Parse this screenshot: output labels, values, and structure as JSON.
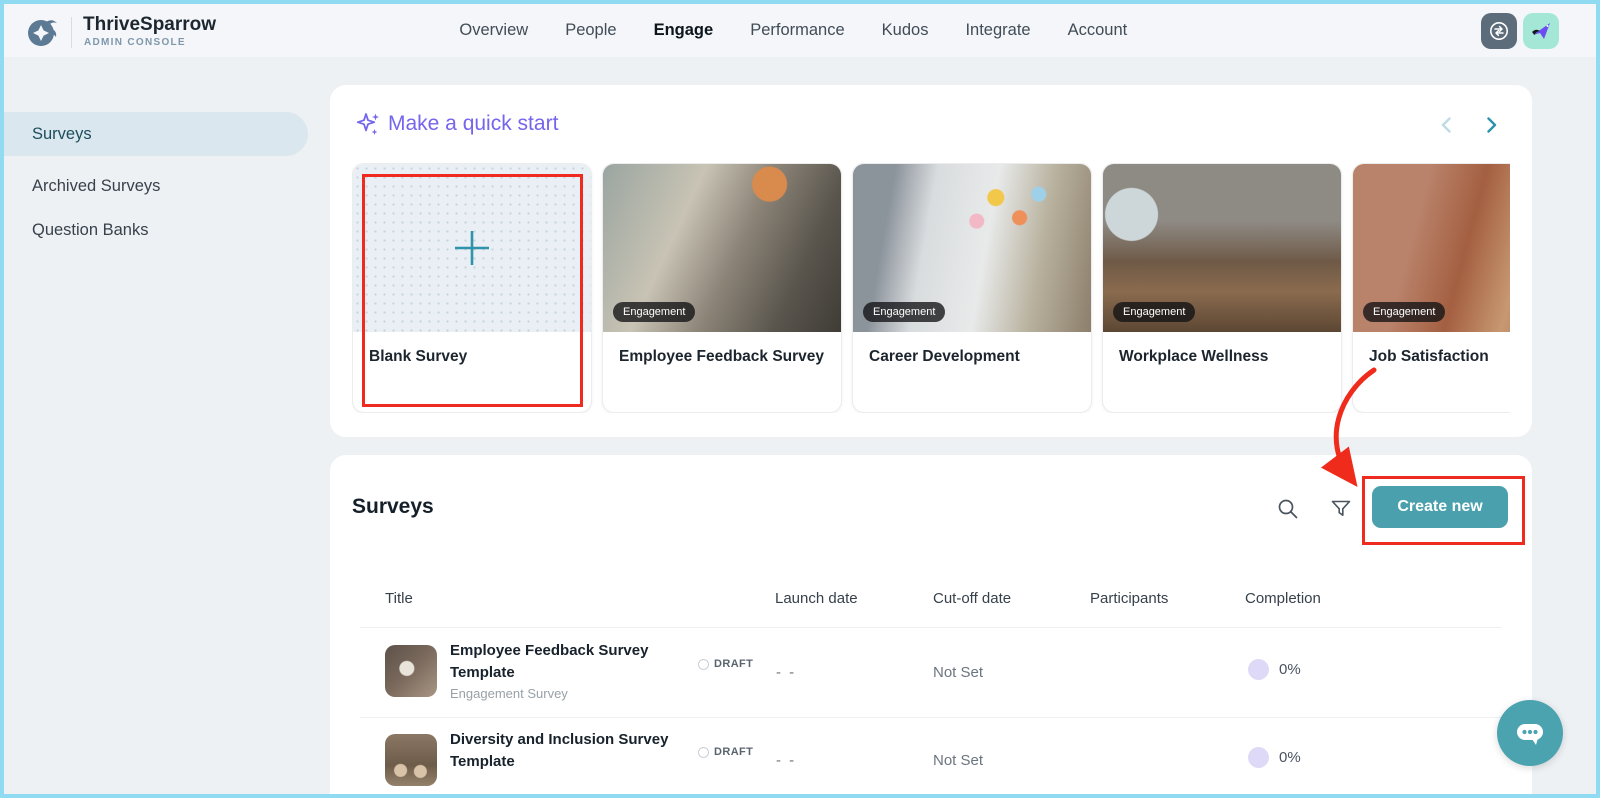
{
  "topbar": {
    "brand": "ThriveSparrow",
    "brand_sub": "ADMIN CONSOLE",
    "nav": [
      {
        "label": "Overview",
        "active": false
      },
      {
        "label": "People",
        "active": false
      },
      {
        "label": "Engage",
        "active": true
      },
      {
        "label": "Performance",
        "active": false
      },
      {
        "label": "Kudos",
        "active": false
      },
      {
        "label": "Integrate",
        "active": false
      },
      {
        "label": "Account",
        "active": false
      }
    ]
  },
  "sidebar": {
    "items": [
      {
        "label": "Surveys",
        "active": true
      },
      {
        "label": "Archived Surveys",
        "active": false
      },
      {
        "label": "Question Banks",
        "active": false
      }
    ]
  },
  "quick_start": {
    "title": "Make a quick start",
    "carousel": {
      "prev_enabled": false,
      "next_enabled": true
    },
    "cards": [
      {
        "title": "Blank Survey",
        "type": "blank",
        "annotated": true
      },
      {
        "title": "Employee Feedback Survey",
        "badge": "Engagement"
      },
      {
        "title": "Career Development",
        "badge": "Engagement"
      },
      {
        "title": "Workplace Wellness",
        "badge": "Engagement"
      },
      {
        "title": "Job Satisfaction",
        "badge": "Engagement"
      }
    ]
  },
  "surveys_panel": {
    "title": "Surveys",
    "create_button": "Create new",
    "columns": [
      "Title",
      "Launch date",
      "Cut-off date",
      "Participants",
      "Completion"
    ],
    "rows": [
      {
        "title": "Employee Feedback Survey Template",
        "subtitle": "Engagement Survey",
        "status": "DRAFT",
        "launch_date": "- -",
        "cutoff_date": "Not Set",
        "participants": "",
        "completion": "0%"
      },
      {
        "title": "Diversity and Inclusion Survey Template",
        "subtitle": "",
        "status": "DRAFT",
        "launch_date": "- -",
        "cutoff_date": "Not Set",
        "participants": "",
        "completion": "0%"
      }
    ]
  },
  "icons": {
    "logo": "sparrow-logo-icon",
    "topbar_right": [
      "switch-apps-icon",
      "sparrow-app-icon"
    ],
    "quick_start": "sparkles-icon",
    "carousel": [
      "chevron-left-icon",
      "chevron-right-icon"
    ],
    "surveys_header": [
      "search-icon",
      "filter-funnel-icon"
    ],
    "chat": "chat-bubble-icon"
  },
  "colors": {
    "accent_teal": "#4AA0AD",
    "accent_purple": "#7465EE",
    "annotation_red": "#EE2B1E",
    "frame_border": "#90DAF2",
    "sidebar_active_bg": "#DBE7EE",
    "mint_button": "#A5E7D6",
    "slate_button": "#5D6C7B",
    "completion_dot": "#DED9F7",
    "badge_bg": "#121214C7"
  }
}
